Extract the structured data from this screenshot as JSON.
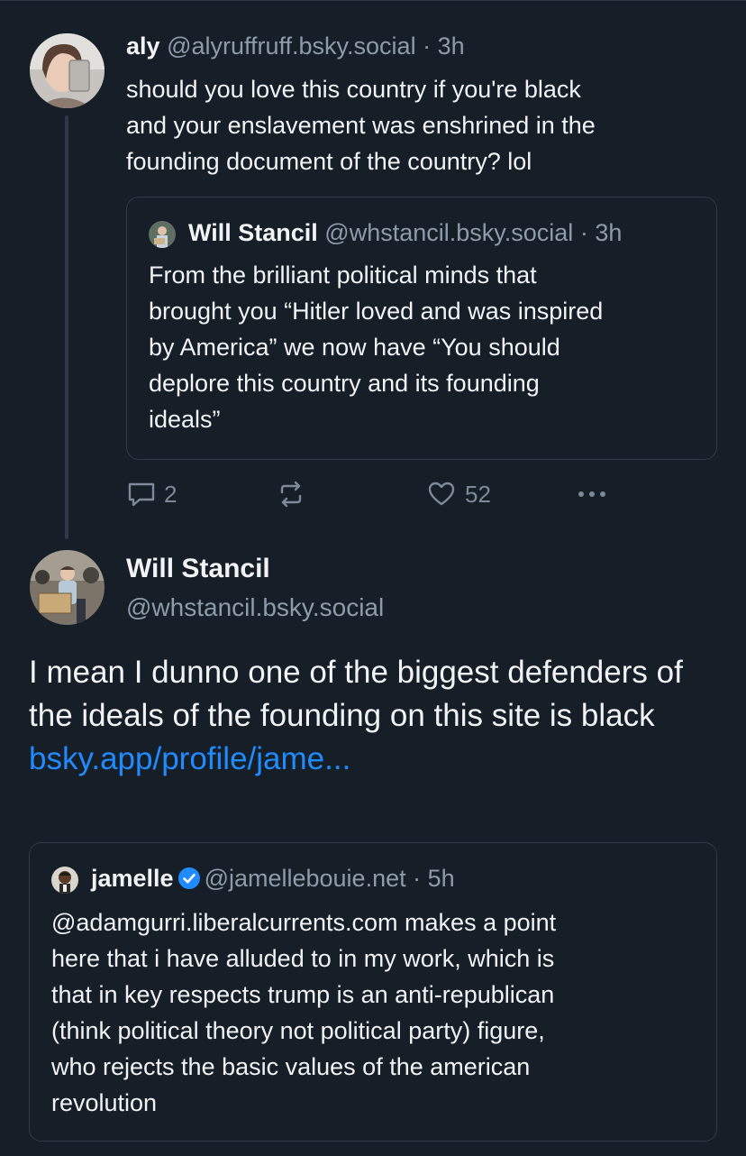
{
  "parent_post": {
    "author_name": "aly",
    "handle": "@alyruffruff.bsky.social",
    "separator": "·",
    "time": "3h",
    "text": "should you love this country if you're black\nand your enslavement was enshrined in the\nfounding document of the country? lol",
    "quote": {
      "author_name": "Will Stancil",
      "handle": "@whstancil.bsky.social",
      "separator": "·",
      "time": "3h",
      "text": "From the brilliant political minds that\nbrought you “Hitler loved and was inspired\nby America” we now have “You should\ndeplore this country and its founding\nideals”"
    },
    "actions": {
      "reply_count": "2",
      "repost_count": "",
      "like_count": "52"
    }
  },
  "main_post": {
    "author_name": "Will Stancil",
    "handle": "@whstancil.bsky.social",
    "text": "I mean I dunno one of the biggest defenders of the ideals of the founding on this site is black ",
    "link_text": "bsky.app/profile/jame...",
    "quote": {
      "author_name": "jamelle",
      "handle": "@jamellebouie.net",
      "separator": "·",
      "time": "5h",
      "text": "@adamgurri.liberalcurrents.com makes a point\nhere that i have alluded to in my work, which is\nthat in key respects trump is an anti-republican\n(think political theory not political party) figure,\nwho rejects the basic values of the american\nrevolution"
    }
  },
  "colors": {
    "background": "#161e27",
    "text": "#f1f3f5",
    "muted": "#8d9baa",
    "link": "#208bfe",
    "border": "#2e3b4a"
  },
  "icons": [
    "reply-icon",
    "repost-icon",
    "like-icon",
    "more-icon",
    "verified-badge-icon"
  ]
}
